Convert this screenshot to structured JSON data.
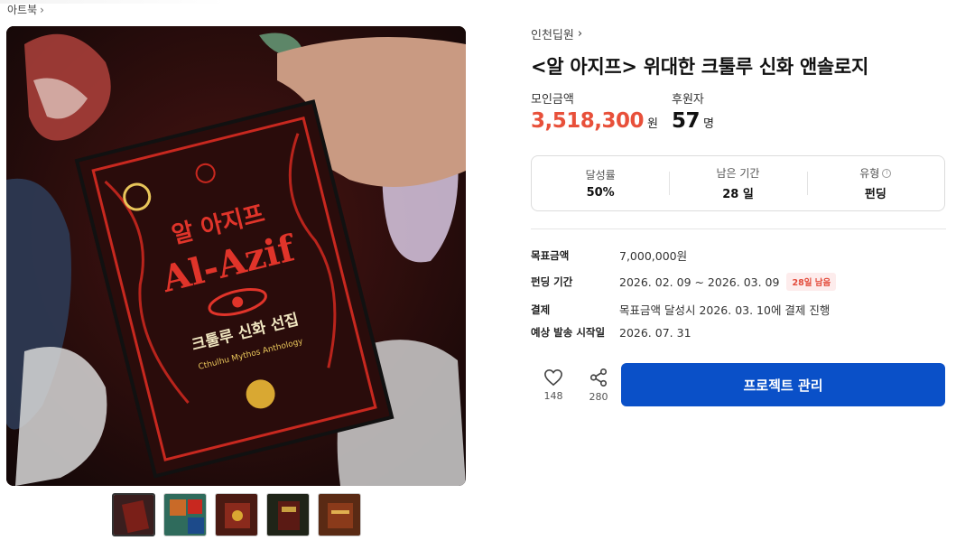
{
  "breadcrumb": {
    "label": "아트북"
  },
  "gallery": {
    "cover_title_korean": "알 아지프",
    "cover_title_latin": "Al-Azif",
    "cover_subtitle_korean": "크툴루 신화 선집",
    "cover_subtitle_latin": "Cthulhu Mythos Anthology",
    "thumbnails": [
      {
        "name": "thumbnail-1",
        "tone": "#3a1e1e"
      },
      {
        "name": "thumbnail-2",
        "tone": "#2f6b5c"
      },
      {
        "name": "thumbnail-3",
        "tone": "#4a1a12"
      },
      {
        "name": "thumbnail-4",
        "tone": "#1f2418"
      },
      {
        "name": "thumbnail-5",
        "tone": "#5a2a14"
      }
    ]
  },
  "project": {
    "creator": "인천딥원",
    "title": "<알 아지프> 위대한 크툴루 신화 앤솔로지"
  },
  "stats": {
    "raised_label": "모인금액",
    "raised_value": "3,518,300",
    "raised_unit": "원",
    "backers_label": "후원자",
    "backers_value": "57",
    "backers_unit": "명"
  },
  "summary": {
    "achievement_label": "달성률",
    "achievement_value": "50%",
    "remaining_label": "남은 기간",
    "remaining_value": "28 일",
    "type_label": "유형",
    "type_info_icon": "ⓘ",
    "type_value": "펀딩"
  },
  "details": {
    "goal_label": "목표금액",
    "goal_value": "7,000,000원",
    "period_label": "펀딩 기간",
    "period_value": "2026. 02. 09 ~ 2026. 03. 09",
    "period_badge": "28일 남음",
    "payment_label": "결제",
    "payment_value": "목표금액 달성시 2026. 03. 10에 결제 진행",
    "shipping_label": "예상 발송 시작일",
    "shipping_value": "2026. 07. 31"
  },
  "actions": {
    "like_count": "148",
    "share_count": "280",
    "manage_label": "프로젝트 관리"
  },
  "colors": {
    "accent_red": "#e8503a",
    "primary_blue": "#0a50c8",
    "badge_bg": "#fdecec"
  }
}
